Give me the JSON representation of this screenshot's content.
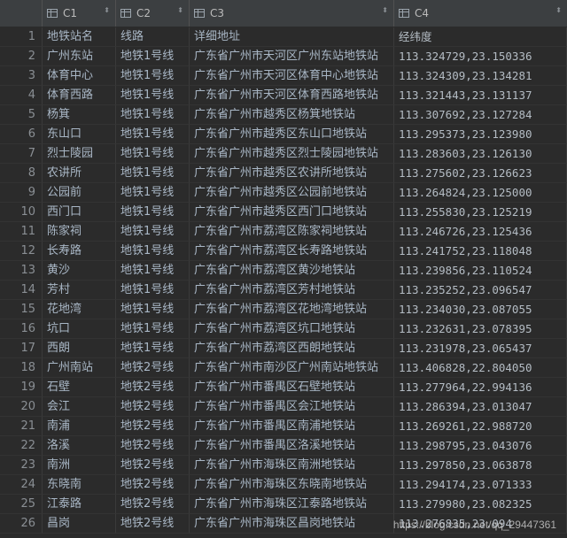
{
  "columns": [
    {
      "name": "C1",
      "icon": "table-column-icon"
    },
    {
      "name": "C2",
      "icon": "table-column-icon"
    },
    {
      "name": "C3",
      "icon": "table-column-icon"
    },
    {
      "name": "C4",
      "icon": "table-column-icon"
    }
  ],
  "sort_glyph": "⬍",
  "rows": [
    {
      "num": "1",
      "c1": "地铁站名",
      "c2": "线路",
      "c3": "详细地址",
      "c4": "经纬度"
    },
    {
      "num": "2",
      "c1": "广州东站",
      "c2": "地铁1号线",
      "c3": "广东省广州市天河区广州东站地铁站",
      "c4": "113.324729,23.150336"
    },
    {
      "num": "3",
      "c1": "体育中心",
      "c2": "地铁1号线",
      "c3": "广东省广州市天河区体育中心地铁站",
      "c4": "113.324309,23.134281"
    },
    {
      "num": "4",
      "c1": "体育西路",
      "c2": "地铁1号线",
      "c3": "广东省广州市天河区体育西路地铁站",
      "c4": "113.321443,23.131137"
    },
    {
      "num": "5",
      "c1": "杨箕",
      "c2": "地铁1号线",
      "c3": "广东省广州市越秀区杨箕地铁站",
      "c4": "113.307692,23.127284"
    },
    {
      "num": "6",
      "c1": "东山口",
      "c2": "地铁1号线",
      "c3": "广东省广州市越秀区东山口地铁站",
      "c4": "113.295373,23.123980"
    },
    {
      "num": "7",
      "c1": "烈士陵园",
      "c2": "地铁1号线",
      "c3": "广东省广州市越秀区烈士陵园地铁站",
      "c4": "113.283603,23.126130"
    },
    {
      "num": "8",
      "c1": "农讲所",
      "c2": "地铁1号线",
      "c3": "广东省广州市越秀区农讲所地铁站",
      "c4": "113.275602,23.126623"
    },
    {
      "num": "9",
      "c1": "公园前",
      "c2": "地铁1号线",
      "c3": "广东省广州市越秀区公园前地铁站",
      "c4": "113.264824,23.125000"
    },
    {
      "num": "10",
      "c1": "西门口",
      "c2": "地铁1号线",
      "c3": "广东省广州市越秀区西门口地铁站",
      "c4": "113.255830,23.125219"
    },
    {
      "num": "11",
      "c1": "陈家祠",
      "c2": "地铁1号线",
      "c3": "广东省广州市荔湾区陈家祠地铁站",
      "c4": "113.246726,23.125436"
    },
    {
      "num": "12",
      "c1": "长寿路",
      "c2": "地铁1号线",
      "c3": "广东省广州市荔湾区长寿路地铁站",
      "c4": "113.241752,23.118048"
    },
    {
      "num": "13",
      "c1": "黄沙",
      "c2": "地铁1号线",
      "c3": "广东省广州市荔湾区黄沙地铁站",
      "c4": "113.239856,23.110524"
    },
    {
      "num": "14",
      "c1": "芳村",
      "c2": "地铁1号线",
      "c3": "广东省广州市荔湾区芳村地铁站",
      "c4": "113.235252,23.096547"
    },
    {
      "num": "15",
      "c1": "花地湾",
      "c2": "地铁1号线",
      "c3": "广东省广州市荔湾区花地湾地铁站",
      "c4": "113.234030,23.087055"
    },
    {
      "num": "16",
      "c1": "坑口",
      "c2": "地铁1号线",
      "c3": "广东省广州市荔湾区坑口地铁站",
      "c4": "113.232631,23.078395"
    },
    {
      "num": "17",
      "c1": "西朗",
      "c2": "地铁1号线",
      "c3": "广东省广州市荔湾区西朗地铁站",
      "c4": "113.231978,23.065437"
    },
    {
      "num": "18",
      "c1": "广州南站",
      "c2": "地铁2号线",
      "c3": "广东省广州市南沙区广州南站地铁站",
      "c4": "113.406828,22.804050"
    },
    {
      "num": "19",
      "c1": "石壁",
      "c2": "地铁2号线",
      "c3": "广东省广州市番禺区石壁地铁站",
      "c4": "113.277964,22.994136"
    },
    {
      "num": "20",
      "c1": "会江",
      "c2": "地铁2号线",
      "c3": "广东省广州市番禺区会江地铁站",
      "c4": "113.286394,23.013047"
    },
    {
      "num": "21",
      "c1": "南浦",
      "c2": "地铁2号线",
      "c3": "广东省广州市番禺区南浦地铁站",
      "c4": "113.269261,22.988720"
    },
    {
      "num": "22",
      "c1": "洛溪",
      "c2": "地铁2号线",
      "c3": "广东省广州市番禺区洛溪地铁站",
      "c4": "113.298795,23.043076"
    },
    {
      "num": "23",
      "c1": "南洲",
      "c2": "地铁2号线",
      "c3": "广东省广州市海珠区南洲地铁站",
      "c4": "113.297850,23.063878"
    },
    {
      "num": "24",
      "c1": "东晓南",
      "c2": "地铁2号线",
      "c3": "广东省广州市海珠区东晓南地铁站",
      "c4": "113.294174,23.071333"
    },
    {
      "num": "25",
      "c1": "江泰路",
      "c2": "地铁2号线",
      "c3": "广东省广州市海珠区江泰路地铁站",
      "c4": "113.279980,23.082325"
    },
    {
      "num": "26",
      "c1": "昌岗",
      "c2": "地铁2号线",
      "c3": "广东省广州市海珠区昌岗地铁站",
      "c4": "113.276835,23.094"
    }
  ],
  "watermark": "https://blog.csdn.net/qq_29447361"
}
